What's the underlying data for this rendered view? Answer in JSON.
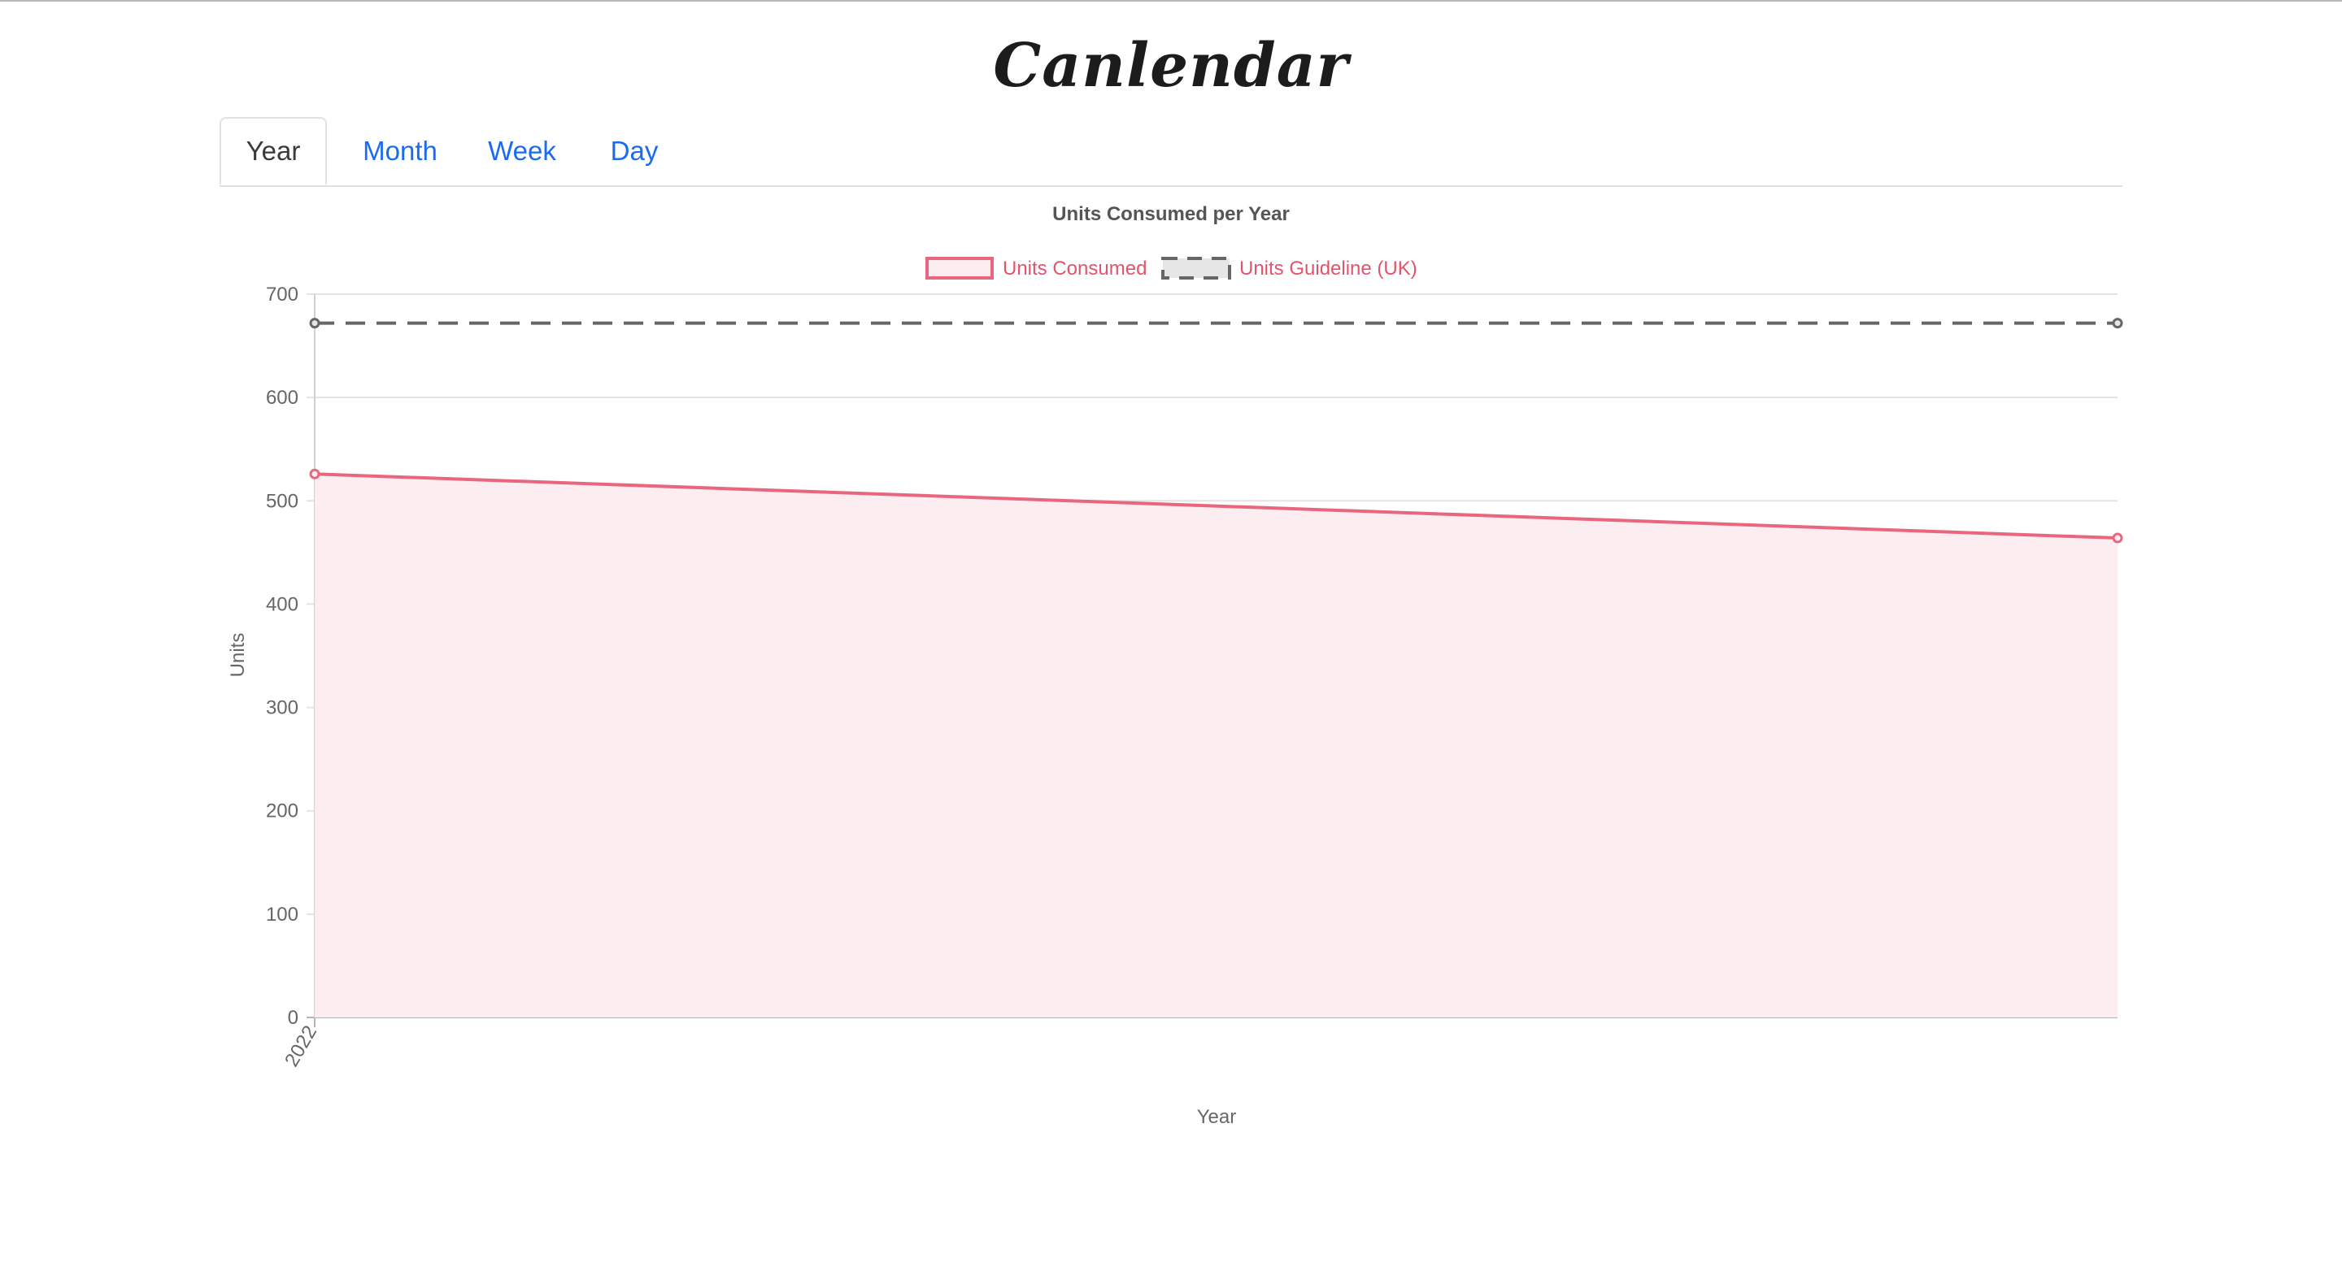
{
  "app": {
    "title": "Canlendar"
  },
  "tabs": [
    {
      "label": "Year",
      "active": true
    },
    {
      "label": "Month",
      "active": false
    },
    {
      "label": "Week",
      "active": false
    },
    {
      "label": "Day",
      "active": false
    }
  ],
  "chart_data": {
    "type": "line",
    "title": "Units Consumed per Year",
    "xlabel": "Year",
    "ylabel": "Units",
    "x_tick_labels": [
      "2022"
    ],
    "ylim": [
      0,
      700
    ],
    "yticks": [
      0,
      100,
      200,
      300,
      400,
      500,
      600,
      700
    ],
    "grid": true,
    "legend_position": "top-center",
    "series": [
      {
        "name": "Units Consumed",
        "values": [
          526,
          464
        ],
        "color": "#e8677f",
        "fill": "#fcedf0",
        "dashed": false,
        "filled": true
      },
      {
        "name": "Units Guideline (UK)",
        "values": [
          672,
          672
        ],
        "color": "#666666",
        "fill": "#e6e6e6",
        "dashed": true,
        "filled": false
      }
    ]
  }
}
